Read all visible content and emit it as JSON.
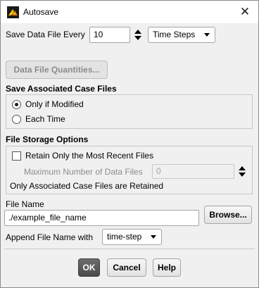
{
  "window": {
    "title": "Autosave",
    "close_glyph": "✕",
    "icon": "ansys-fluent-icon"
  },
  "save_every": {
    "label": "Save Data File Every",
    "value": "10",
    "unit_selected": "Time Steps"
  },
  "data_file_quantities_button": "Data File Quantities...",
  "case_files": {
    "heading": "Save Associated Case Files",
    "options": [
      "Only if Modified",
      "Each Time"
    ],
    "selected": "Only if Modified"
  },
  "storage": {
    "heading": "File Storage Options",
    "retain_label": "Retain Only the Most Recent Files",
    "retain_checked": false,
    "max_label": "Maximum Number of Data Files",
    "max_value": "0",
    "note": "Only Associated Case Files are Retained"
  },
  "file_name": {
    "label": "File Name",
    "value": "./example_file_name",
    "browse_label": "Browse..."
  },
  "append": {
    "label": "Append File Name with",
    "selected": "time-step"
  },
  "buttons": {
    "ok": "OK",
    "cancel": "Cancel",
    "help": "Help"
  }
}
